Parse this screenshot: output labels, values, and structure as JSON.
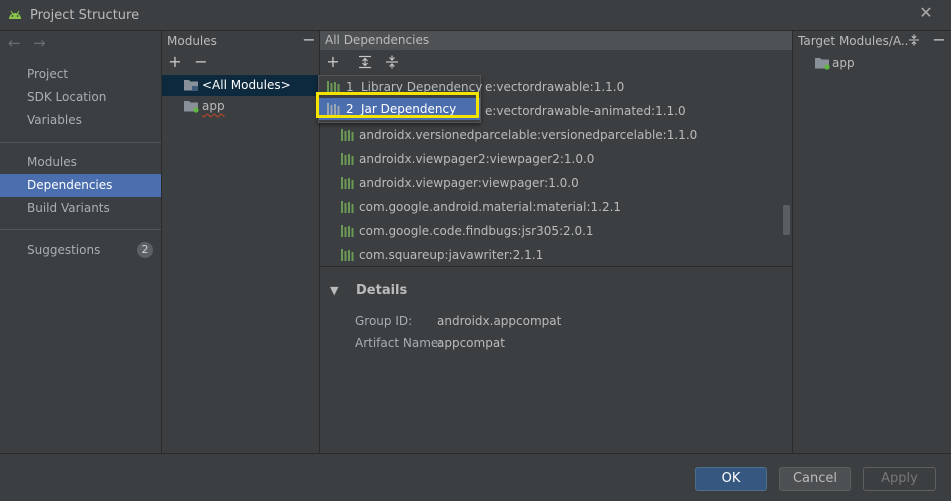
{
  "window": {
    "title": "Project Structure",
    "icon": "android-icon",
    "close_icon": "close-icon"
  },
  "nav": {
    "back_icon": "arrow-left-icon",
    "forward_icon": "arrow-right-icon",
    "items": [
      {
        "label": "Project"
      },
      {
        "label": "SDK Location"
      },
      {
        "label": "Variables"
      },
      {
        "label": "Modules"
      },
      {
        "label": "Dependencies",
        "selected": true
      },
      {
        "label": "Build Variants"
      },
      {
        "label": "Suggestions",
        "badge": "2"
      }
    ]
  },
  "modules_panel": {
    "title": "Modules",
    "items": [
      {
        "label": "<All Modules>",
        "selected": true
      },
      {
        "label": "app"
      }
    ]
  },
  "deps_panel": {
    "title": "All Dependencies",
    "rows": [
      {
        "label": "e:vectordrawable:1.1.0"
      },
      {
        "label": "e:vectordrawable-animated:1.1.0"
      },
      {
        "label": "androidx.versionedparcelable:versionedparcelable:1.1.0"
      },
      {
        "label": "androidx.viewpager2:viewpager2:1.0.0"
      },
      {
        "label": "androidx.viewpager:viewpager:1.0.0"
      },
      {
        "label": "com.google.android.material:material:1.2.1"
      },
      {
        "label": "com.google.code.findbugs:jsr305:2.0.1"
      },
      {
        "label": "com.squareup:javawriter:2.1.1"
      }
    ],
    "popup": [
      {
        "num": "1",
        "label": "Library Dependency"
      },
      {
        "num": "2",
        "label": "Jar Dependency",
        "selected": true
      }
    ],
    "details": {
      "title": "Details",
      "group_label": "Group ID:",
      "group_value": "androidx.appcompat",
      "artifact_label": "Artifact Name:",
      "artifact_value": "appcompat"
    }
  },
  "target_panel": {
    "title": "Target Modules/A...",
    "items": [
      {
        "label": "app"
      }
    ]
  },
  "buttons": {
    "ok": "OK",
    "cancel": "Cancel",
    "apply": "Apply"
  },
  "colors": {
    "accent": "#4b6eaf",
    "highlight": "#f5e400",
    "ok_button": "#365880",
    "library_icon": "#6a9955"
  }
}
